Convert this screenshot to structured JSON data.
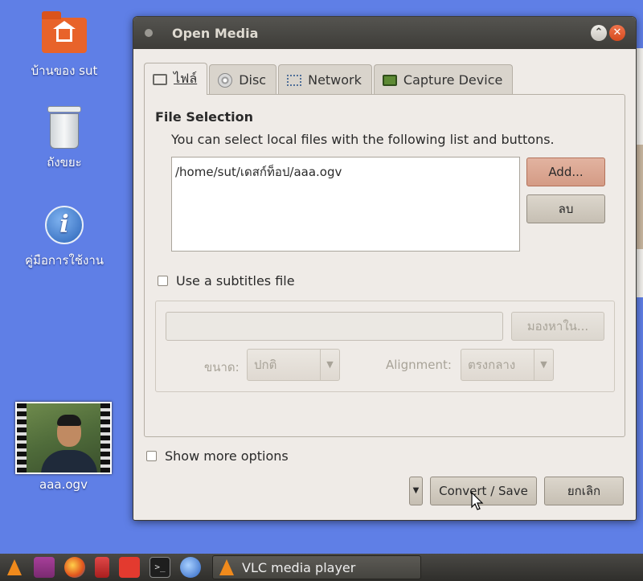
{
  "desktop": {
    "icons": [
      {
        "label": "บ้านของ sut",
        "icon": "home-folder-icon"
      },
      {
        "label": "ถังขยะ",
        "icon": "trash-icon"
      },
      {
        "label": "คู่มือการใช้งาน",
        "icon": "help-info-icon"
      },
      {
        "label": "aaa.ogv",
        "icon": "video-thumbnail"
      }
    ]
  },
  "dialog": {
    "title": "Open Media",
    "tabs": [
      {
        "label": "ไฟล์",
        "icon": "folder-icon"
      },
      {
        "label": "Disc",
        "icon": "disc-icon"
      },
      {
        "label": "Network",
        "icon": "network-icon"
      },
      {
        "label": "Capture Device",
        "icon": "capture-card-icon"
      }
    ],
    "file_selection": {
      "title": "File Selection",
      "description": "You can select local files with the following list and buttons.",
      "files": [
        "/home/sut/เดสก์ท็อป/aaa.ogv"
      ],
      "add_label": "Add...",
      "remove_label": "ลบ"
    },
    "subtitles": {
      "checkbox_label": "Use a subtitles file",
      "browse_label": "มองหาใน...",
      "size_label": "ขนาด:",
      "size_value": "ปกติ",
      "alignment_label": "Alignment:",
      "alignment_value": "ตรงกลาง"
    },
    "show_more_label": "Show more options",
    "convert_label": "Convert / Save",
    "cancel_label": "ยกเลิก"
  },
  "taskbar": {
    "task_label": "VLC media player"
  },
  "colors": {
    "desktop_bg": "#5f7fe6",
    "dialog_bg": "#efebe7",
    "titlebar": "#3d3c38"
  }
}
